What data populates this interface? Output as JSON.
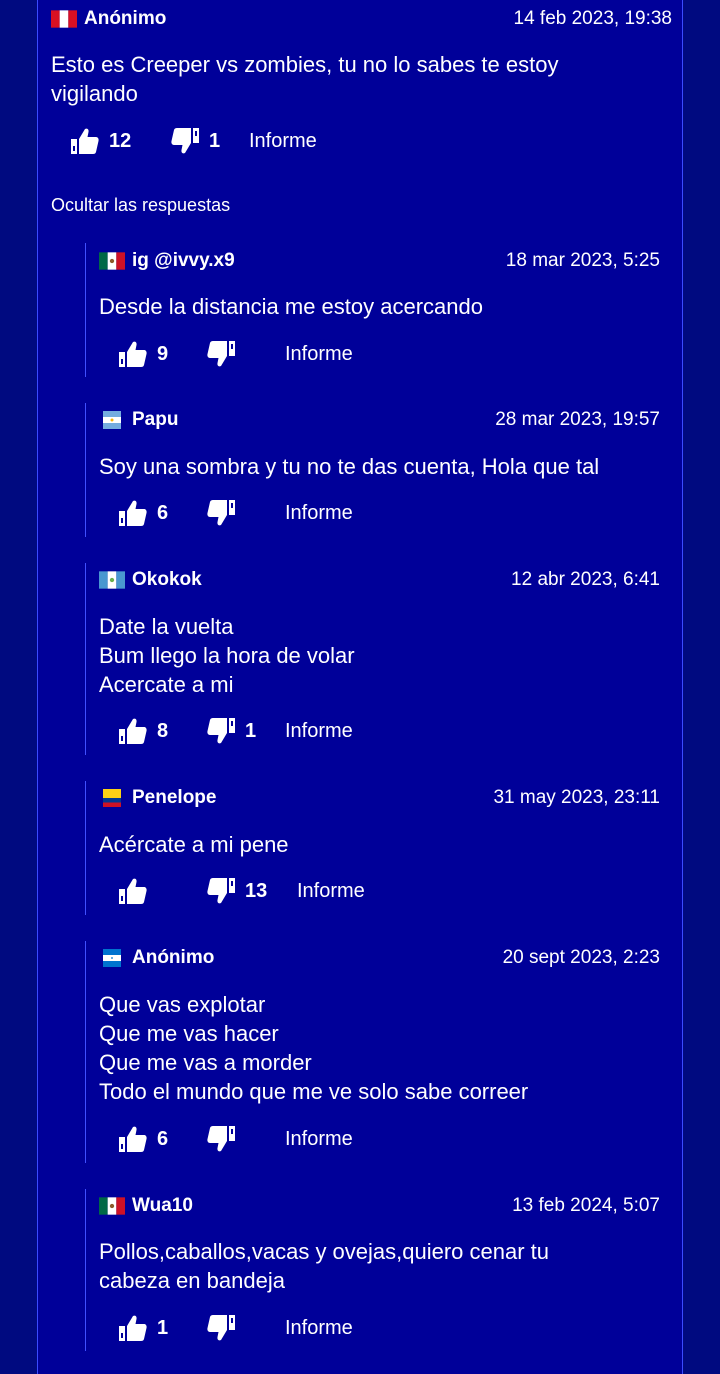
{
  "main_comment": {
    "author": "Anónimo",
    "flag": "peru",
    "date": "14 feb 2023, 19:38",
    "text": "Esto es Creeper vs zombies, tu no lo sabes te estoy\nvigilando",
    "likes": "12",
    "dislikes": "1",
    "report_label": "Informe"
  },
  "replies_toggle": "Ocultar las respuestas",
  "replies": [
    {
      "author": "ig @ivvy.x9",
      "flag": "mexico",
      "date": "18 mar 2023, 5:25",
      "text": "Desde la distancia me estoy acercando",
      "likes": "9",
      "dislikes": "",
      "report_label": "Informe"
    },
    {
      "author": "Papu",
      "flag": "argentina",
      "date": "28 mar 2023, 19:57",
      "text": "Soy una sombra y tu no te das cuenta, Hola que tal",
      "likes": "6",
      "dislikes": "",
      "report_label": "Informe"
    },
    {
      "author": "Okokok",
      "flag": "guatemala",
      "date": "12 abr 2023, 6:41",
      "text": "Date la vuelta\nBum llego la hora de volar\nAcercate a mi",
      "likes": "8",
      "dislikes": "1",
      "report_label": "Informe"
    },
    {
      "author": "Penelope",
      "flag": "colombia",
      "date": "31 may 2023, 23:11",
      "text": "Acércate a mi pene",
      "likes": "",
      "dislikes": "13",
      "report_label": "Informe"
    },
    {
      "author": "Anónimo",
      "flag": "honduras",
      "date": "20 sept 2023, 2:23",
      "text": "Que vas explotar\nQue me vas hacer\nQue me vas a morder\nTodo el mundo que me ve solo sabe correer",
      "likes": "6",
      "dislikes": "",
      "report_label": "Informe"
    },
    {
      "author": "Wua10",
      "flag": "mexico",
      "date": "13 feb 2024, 5:07",
      "text": "Pollos,caballos,vacas y ovejas,quiero cenar tu\ncabeza en bandeja",
      "likes": "1",
      "dislikes": "",
      "report_label": "Informe"
    }
  ],
  "icons": {
    "like": "thumbs-up-icon",
    "dislike": "thumbs-down-icon"
  },
  "colors": {
    "background": "#000a80",
    "panel": "#000099",
    "text": "#ffffff",
    "border": "#3b4bff"
  }
}
